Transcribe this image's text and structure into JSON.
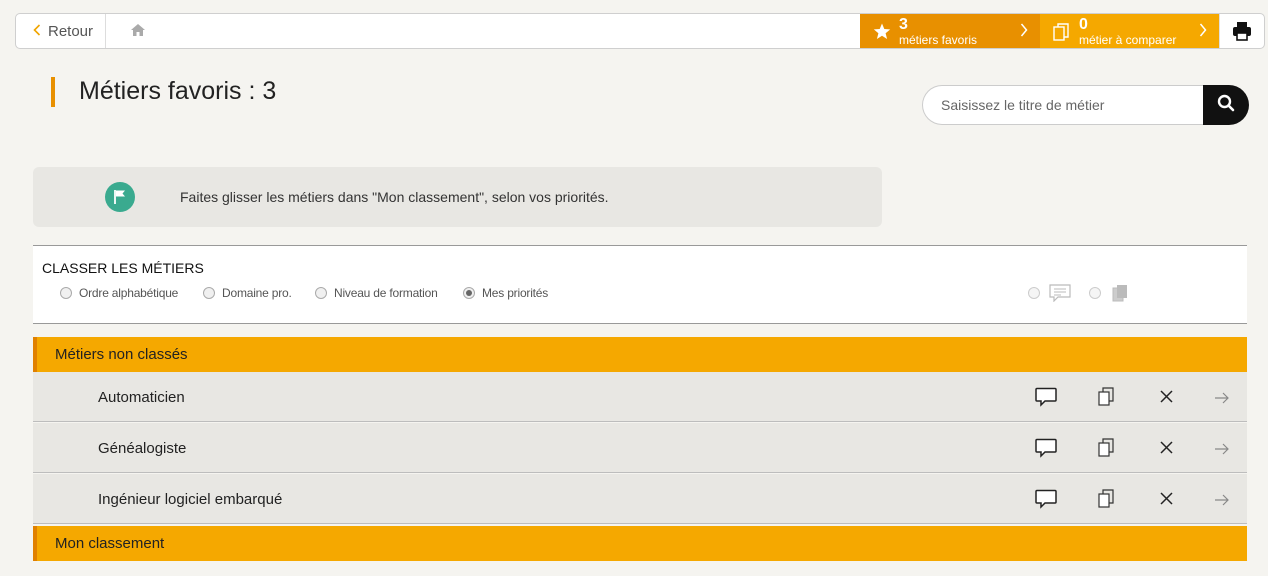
{
  "topbar": {
    "back_label": "Retour",
    "favorites": {
      "count": "3",
      "label": "métiers favoris"
    },
    "compare": {
      "count": "0",
      "label": "métier à comparer"
    }
  },
  "page": {
    "title": "Métiers favoris : 3"
  },
  "search": {
    "placeholder": "Saisissez le titre de métier"
  },
  "info": {
    "text": "Faites glisser les métiers dans \"Mon classement\", selon vos priorités."
  },
  "sort": {
    "title": "CLASSER LES MÉTIERS",
    "options": [
      {
        "label": "Ordre alphabétique",
        "selected": false
      },
      {
        "label": "Domaine pro.",
        "selected": false
      },
      {
        "label": "Niveau de formation",
        "selected": false
      },
      {
        "label": "Mes priorités",
        "selected": true
      }
    ]
  },
  "sections": {
    "unranked": {
      "title": "Métiers non classés"
    },
    "ranking": {
      "title": "Mon classement"
    }
  },
  "jobs": [
    {
      "name": "Automaticien"
    },
    {
      "name": "Généalogiste"
    },
    {
      "name": "Ingénieur logiciel embarqué"
    }
  ],
  "colors": {
    "accent": "#f5a800",
    "accent_dark": "#e89000",
    "flag": "#3aaa8f"
  }
}
